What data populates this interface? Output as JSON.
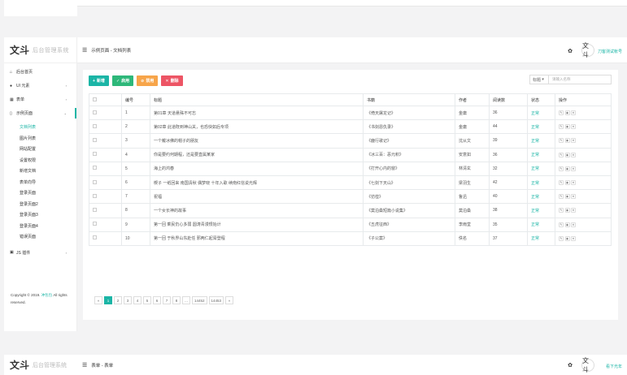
{
  "brand": {
    "logo": "文斗",
    "system": "后台管理系统"
  },
  "sidebar": {
    "items": [
      {
        "label": "后台首页",
        "icon": "home-icon"
      },
      {
        "label": "UI 元素",
        "icon": "palette-icon",
        "arrow": "›"
      },
      {
        "label": "表单",
        "icon": "table-icon",
        "arrow": "›"
      },
      {
        "label": "示例页面",
        "icon": "file-icon",
        "arrow": "⌄"
      }
    ],
    "subitems": [
      "文档列表",
      "图片列表",
      "网站配置",
      "设置权限",
      "新增文档",
      "表单向导",
      "登录页面",
      "登录页面2",
      "登录页面3",
      "登录页面4",
      "错误页面"
    ],
    "extra": {
      "label": "JS 插件",
      "icon": "js-icon",
      "arrow": "›"
    },
    "copyright_prefix": "Copyright © 2019.",
    "copyright_link": "冲包包",
    "copyright_suffix": " All rights reserved."
  },
  "topbar": {
    "breadcrumb": "示例页面 - 文档列表",
    "avatar": "文斗",
    "username": "刀客测试帐号"
  },
  "toolbar": {
    "add": "新增",
    "enable": "启用",
    "disable": "禁用",
    "delete": "删除"
  },
  "search": {
    "select": "标题",
    "placeholder": "请输入名称"
  },
  "table": {
    "headers": [
      "",
      "编号",
      "标题",
      "书籍",
      "作者",
      "阅读数",
      "状态",
      "操作"
    ],
    "rows": [
      [
        "1",
        "第01章 天道悬殊不可忘",
        "《倚天屠龙记》",
        "金庸",
        "36",
        "正常"
      ],
      [
        "2",
        "第02章 此道既到神山关，也恐快如后专项",
        "《书剑恩仇录》",
        "金庸",
        "44",
        "正常"
      ],
      [
        "3",
        "一个戴冰佛的帽子的朋友",
        "《鹿行歌记》",
        "沈从文",
        "39",
        "正常"
      ],
      [
        "4",
        "你是要约何期程，还是要直属某家",
        "《冰三百：恶元积》",
        "安意如",
        "36",
        "正常"
      ],
      [
        "5",
        "海上的鸿春",
        "《打开心内的窗》",
        "林清玄",
        "32",
        "正常"
      ],
      [
        "6",
        "楔子 一纸回来 南国清秋 偶梦晓 十年入歌 续南红信说光辉",
        "《七剑下天山》",
        "梁羽生",
        "42",
        "正常"
      ],
      [
        "7",
        "祝福",
        "《彷徨》",
        "鲁迅",
        "40",
        "正常"
      ],
      [
        "8",
        "一个女长神的故事",
        "《莫泊桑短篇小说集》",
        "莫泊桑",
        "38",
        "正常"
      ],
      [
        "9",
        "第一回 乘民仍心多弱 圆涛青漫恨始计",
        "《五虎征西》",
        "李雨堂",
        "35",
        "正常"
      ],
      [
        "10",
        "第一回 于秋界山东赴任 邪两仁起膏登程",
        "《子公案》",
        "佚名",
        "37",
        "正常"
      ]
    ]
  },
  "pagination": [
    "«",
    "1",
    "2",
    "3",
    "4",
    "5",
    "6",
    "7",
    "8",
    "...",
    "14452",
    "14453",
    "»"
  ],
  "bottom": {
    "logo": "文斗",
    "system": "后台管理系统",
    "breadcrumb": "表单 - 表单",
    "avatar": "文斗",
    "username": "看下光年"
  },
  "colors": {
    "accent": "#1bb5a6",
    "enable": "#2eb87a",
    "disable": "#f7a54a",
    "delete": "#ed5565"
  }
}
